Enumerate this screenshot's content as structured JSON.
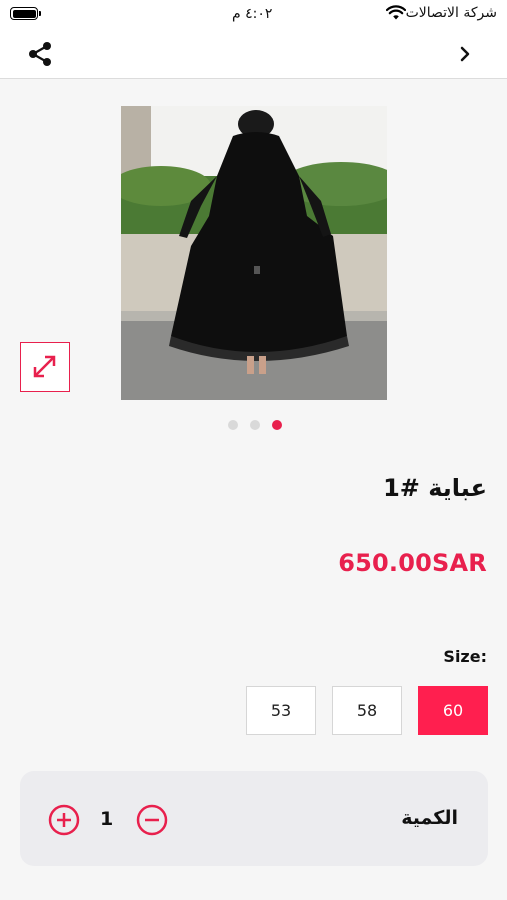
{
  "status_bar": {
    "carrier": "شركة الاتصالات",
    "time": "٤:٠٢ م"
  },
  "nav": {
    "share_icon": "share-icon",
    "back_icon": "chevron-right-icon"
  },
  "product": {
    "title": "عباية #1",
    "price": "650.00SAR",
    "image_count": 3,
    "active_image_index": 2
  },
  "size": {
    "label": "Size:",
    "options": [
      "53",
      "58",
      "60"
    ],
    "selected": "60"
  },
  "quantity": {
    "label": "الكمية",
    "value": "1"
  },
  "colors": {
    "accent": "#ff1f4f",
    "card": "#ececef",
    "background": "#f6f6f6"
  }
}
